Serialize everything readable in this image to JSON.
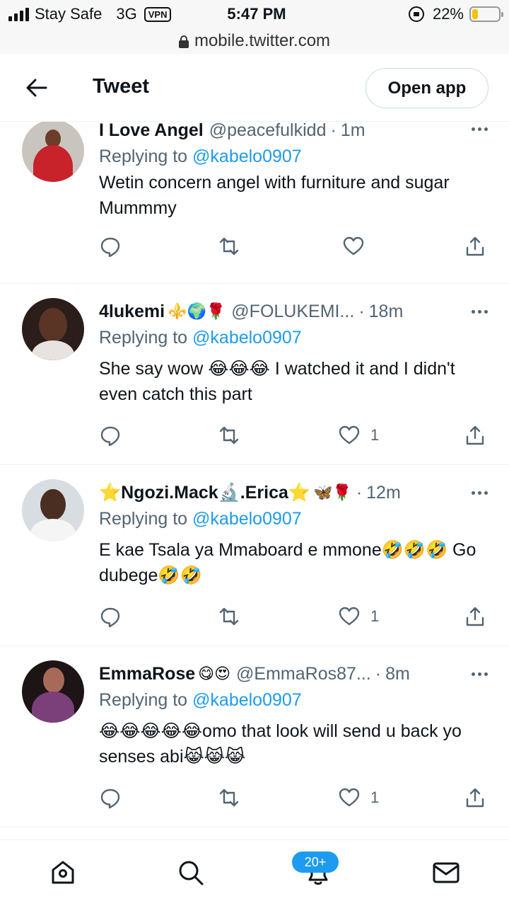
{
  "status_bar": {
    "carrier": "Stay Safe",
    "network": "3G",
    "vpn_label": "VPN",
    "time": "5:47 PM",
    "battery_percent": "22%",
    "battery_level": 0.22,
    "battery_color": "#f4c400"
  },
  "url_bar": {
    "url": "mobile.twitter.com"
  },
  "header": {
    "title": "Tweet",
    "open_app_label": "Open app"
  },
  "tweets": [
    {
      "name": "I Love Angel",
      "name_emojis": "",
      "handle": "@peacefulkidd",
      "time": "1m",
      "replying_prefix": "Replying to",
      "replying_to": "@kabelo0907",
      "text": "Wetin concern angel with furniture and sugar Mummmy",
      "like_count": ""
    },
    {
      "name": "4lukemi",
      "name_emojis": "⚜️🌍🌹",
      "handle": "@FOLUKEMI...",
      "time": "18m",
      "replying_prefix": "Replying to",
      "replying_to": "@kabelo0907",
      "text": "She say wow 😂😂😂 I watched it and I didn't even catch this part",
      "like_count": "1"
    },
    {
      "name": "⭐Ngozi.Mack🔬.Erica⭐",
      "name_emojis": "🦋🌹",
      "handle": "",
      "time": "12m",
      "replying_prefix": "Replying to",
      "replying_to": "@kabelo0907",
      "text": "E kae Tsala ya Mmaboard e mmone🤣🤣🤣 Go dubege🤣🤣",
      "like_count": "1"
    },
    {
      "name": "EmmaRose",
      "name_emojis": "😋😍",
      "handle": "@EmmaRos87...",
      "time": "8m",
      "replying_prefix": "Replying to",
      "replying_to": "@kabelo0907",
      "text": "😂😂😂😂😂omo that look will send u back yo senses abi😹😹😹",
      "like_count": "1"
    }
  ],
  "bottom_nav": {
    "notifications_badge": "20+",
    "items": [
      "home-icon",
      "search-icon",
      "notifications-icon",
      "messages-icon"
    ]
  },
  "colors": {
    "accent": "#1d9bf0",
    "secondary_text": "#536471",
    "divider": "#eff3f4"
  }
}
